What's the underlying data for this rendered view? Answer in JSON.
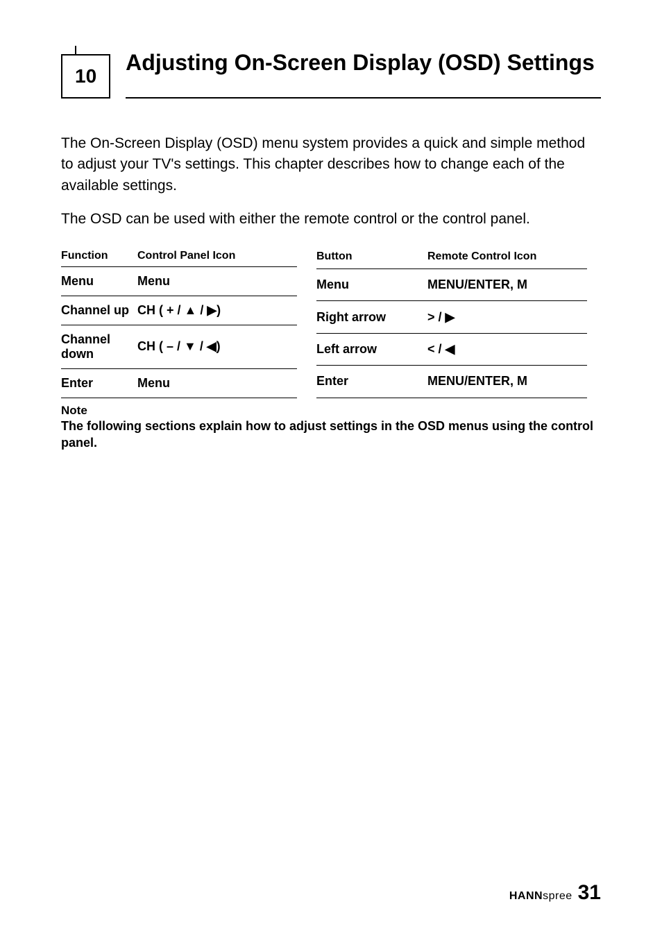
{
  "chapter": {
    "number": "10",
    "title": "Adjusting On-Screen Display (OSD) Settings"
  },
  "paragraphs": {
    "p1": "The On-Screen Display (OSD) menu system provides a quick and simple method to adjust your TV's settings. This chapter describes how to change each of the available settings.",
    "p2": "The OSD can be used with either the remote control or the control panel."
  },
  "table": {
    "headers": {
      "function": "Function",
      "control_panel_icon": "Control Panel Icon",
      "button": "Button",
      "remote_control_icon": "Remote Control Icon"
    },
    "rows": [
      {
        "function": "Menu",
        "control_panel_icon": "Menu",
        "button": "Menu",
        "remote_control_icon": "MENU/ENTER, M"
      },
      {
        "function": "Channel up",
        "control_panel_icon": "CH ( + / ▲ / ▶)",
        "button": "Right arrow",
        "remote_control_icon": "> / ▶"
      },
      {
        "function": "Channel down",
        "control_panel_icon": "CH ( – / ▼ / ◀)",
        "button": "Left arrow",
        "remote_control_icon": "< / ◀"
      },
      {
        "function": "Enter",
        "control_panel_icon": "Menu",
        "button": "Enter",
        "remote_control_icon": "MENU/ENTER, M"
      }
    ]
  },
  "note": {
    "heading": "Note",
    "text": "The following sections explain how to adjust settings in the OSD menus using the control panel."
  },
  "footer": {
    "brand_bold": "HANN",
    "brand_light": "spree",
    "page": "31"
  }
}
